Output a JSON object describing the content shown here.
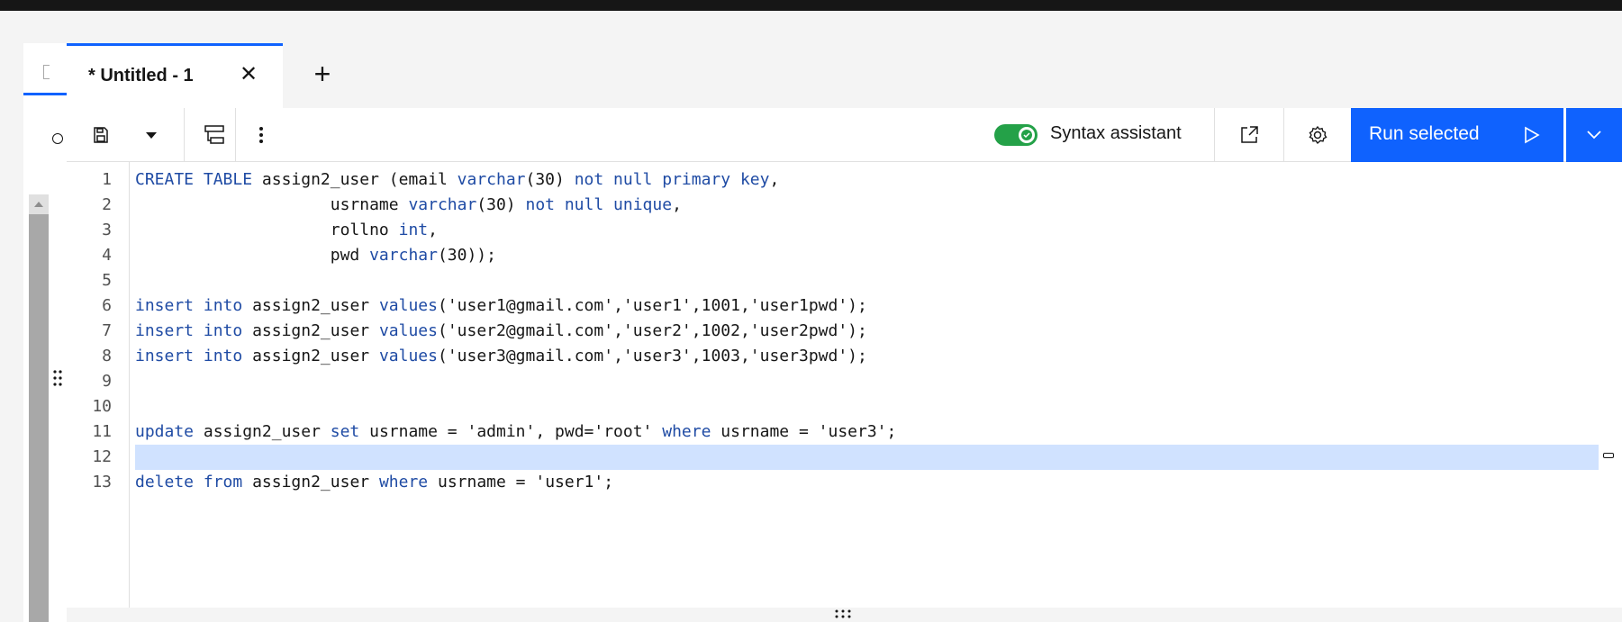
{
  "tab": {
    "label": "* Untitled - 1",
    "close": "✕",
    "add": "+"
  },
  "toolbar": {
    "syntax_assistant_label": "Syntax assistant",
    "syntax_assistant_on": true,
    "run_label": "Run selected"
  },
  "editor": {
    "line_numbers": [
      "1",
      "2",
      "3",
      "4",
      "5",
      "6",
      "7",
      "8",
      "9",
      "10",
      "11",
      "12",
      "13"
    ],
    "lines": [
      "CREATE TABLE assign2_user (email varchar(30) not null primary key,",
      "                    usrname varchar(30) not null unique,",
      "                    rollno int,",
      "                    pwd varchar(30));",
      "",
      "insert into assign2_user values('user1@gmail.com','user1',1001,'user1pwd');",
      "insert into assign2_user values('user2@gmail.com','user2',1002,'user2pwd');",
      "insert into assign2_user values('user3@gmail.com','user3',1003,'user3pwd');",
      "",
      "",
      "update assign2_user set usrname = 'admin', pwd='root' where usrname = 'user3';",
      "",
      "delete from assign2_user where usrname = 'user1';"
    ],
    "highlighted_line": 12
  },
  "colors": {
    "accent": "#0f62fe",
    "toggle_on": "#24a148",
    "keyword": "#1f4ba4",
    "selection": "#d0e2ff"
  },
  "icons": {
    "save": "save-icon",
    "save_dropdown": "caret-down-icon",
    "format": "format-icon",
    "overflow": "overflow-menu-icon",
    "popout": "launch-icon",
    "settings": "settings-icon",
    "run": "play-icon",
    "run_dropdown": "chevron-down-icon"
  }
}
